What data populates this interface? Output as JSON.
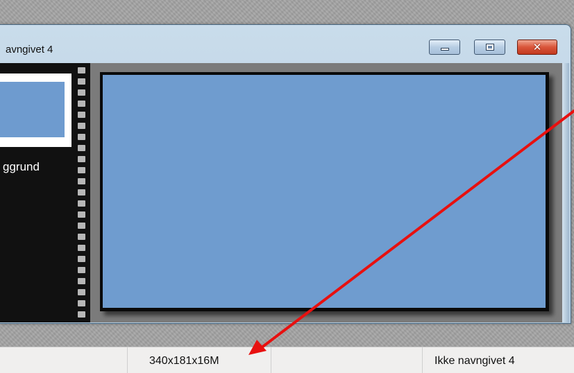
{
  "window": {
    "title": "avngivet 4",
    "buttons": {
      "minimize": "minimize-icon",
      "maximize": "maximize-icon",
      "close": "close-icon"
    }
  },
  "layers_panel": {
    "thumbnail_label": "ggrund"
  },
  "canvas": {
    "color": "#6f9ccf"
  },
  "status_bar": {
    "dimensions": "340x181x16M",
    "document_name": "Ikke navngivet 4"
  },
  "annotation": {
    "arrow_color": "#e8100f"
  }
}
